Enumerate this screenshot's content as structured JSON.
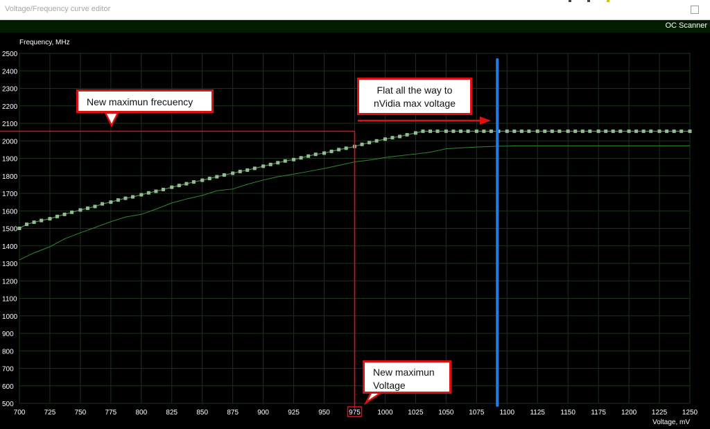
{
  "window": {
    "title": "Voltage/Frequency curve editor",
    "oc_scanner_label": "OC Scanner"
  },
  "annotations": {
    "max_frequency": "New maximun frecuency",
    "flat_line1": "Flat all the way to",
    "flat_line2": "nVidia max voltage",
    "max_voltage_line1": "New maximun",
    "max_voltage_line2": "Voltage",
    "highlighted_tick": "975",
    "highlight_voltage": 975,
    "highlight_frequency": 2055,
    "vertical_marker_voltage": 1092,
    "colors": {
      "annotation": "#e01010",
      "marker": "#1e7ee6",
      "curve": "#8fbf8f",
      "base_curve": "#2e8b2e"
    }
  },
  "chart_data": {
    "type": "line",
    "ylabel": "Frequency, MHz",
    "xlabel": "Voltage, mV",
    "xlim": [
      700,
      1250
    ],
    "ylim": [
      500,
      2500
    ],
    "x_ticks": [
      700,
      725,
      750,
      775,
      800,
      825,
      850,
      875,
      900,
      925,
      950,
      975,
      1000,
      1025,
      1050,
      1075,
      1100,
      1125,
      1150,
      1175,
      1200,
      1225,
      1250
    ],
    "y_ticks": [
      500,
      600,
      700,
      800,
      900,
      1000,
      1100,
      1200,
      1300,
      1400,
      1500,
      1600,
      1700,
      1800,
      1900,
      2000,
      2100,
      2200,
      2300,
      2400,
      2500
    ],
    "grid": true,
    "series": [
      {
        "role": "edited-curve-with-points",
        "points": [
          [
            700,
            1500
          ],
          [
            706,
            1523
          ],
          [
            712,
            1535
          ],
          [
            718,
            1545
          ],
          [
            725,
            1555
          ],
          [
            731,
            1568
          ],
          [
            737,
            1580
          ],
          [
            743,
            1592
          ],
          [
            750,
            1605
          ],
          [
            756,
            1615
          ],
          [
            762,
            1625
          ],
          [
            768,
            1640
          ],
          [
            775,
            1650
          ],
          [
            781,
            1662
          ],
          [
            787,
            1672
          ],
          [
            793,
            1680
          ],
          [
            800,
            1692
          ],
          [
            806,
            1703
          ],
          [
            812,
            1712
          ],
          [
            818,
            1722
          ],
          [
            825,
            1735
          ],
          [
            831,
            1745
          ],
          [
            837,
            1755
          ],
          [
            843,
            1765
          ],
          [
            850,
            1775
          ],
          [
            856,
            1785
          ],
          [
            862,
            1795
          ],
          [
            868,
            1805
          ],
          [
            875,
            1815
          ],
          [
            881,
            1825
          ],
          [
            887,
            1833
          ],
          [
            893,
            1843
          ],
          [
            900,
            1855
          ],
          [
            906,
            1865
          ],
          [
            912,
            1875
          ],
          [
            918,
            1885
          ],
          [
            925,
            1893
          ],
          [
            931,
            1903
          ],
          [
            937,
            1913
          ],
          [
            943,
            1923
          ],
          [
            950,
            1930
          ],
          [
            956,
            1940
          ],
          [
            962,
            1950
          ],
          [
            968,
            1958
          ],
          [
            975,
            1968
          ],
          [
            981,
            1980
          ],
          [
            987,
            1990
          ],
          [
            993,
            2000
          ],
          [
            1000,
            2010
          ],
          [
            1006,
            2018
          ],
          [
            1012,
            2025
          ],
          [
            1018,
            2035
          ],
          [
            1025,
            2045
          ],
          [
            1031,
            2055
          ],
          [
            1037,
            2055
          ],
          [
            1043,
            2055
          ],
          [
            1050,
            2055
          ],
          [
            1056,
            2055
          ],
          [
            1062,
            2055
          ],
          [
            1068,
            2055
          ],
          [
            1075,
            2055
          ],
          [
            1081,
            2055
          ],
          [
            1087,
            2055
          ],
          [
            1093,
            2055
          ],
          [
            1100,
            2055
          ],
          [
            1106,
            2055
          ],
          [
            1112,
            2055
          ],
          [
            1118,
            2055
          ],
          [
            1125,
            2055
          ],
          [
            1131,
            2055
          ],
          [
            1137,
            2055
          ],
          [
            1143,
            2055
          ],
          [
            1150,
            2055
          ],
          [
            1156,
            2055
          ],
          [
            1162,
            2055
          ],
          [
            1168,
            2055
          ],
          [
            1175,
            2055
          ],
          [
            1181,
            2055
          ],
          [
            1187,
            2055
          ],
          [
            1193,
            2055
          ],
          [
            1200,
            2055
          ],
          [
            1206,
            2055
          ],
          [
            1212,
            2055
          ],
          [
            1218,
            2055
          ],
          [
            1225,
            2055
          ],
          [
            1231,
            2055
          ],
          [
            1237,
            2055
          ],
          [
            1243,
            2055
          ],
          [
            1250,
            2055
          ]
        ]
      },
      {
        "role": "base-curve",
        "points": [
          [
            700,
            1320
          ],
          [
            712,
            1360
          ],
          [
            725,
            1395
          ],
          [
            737,
            1440
          ],
          [
            750,
            1475
          ],
          [
            762,
            1505
          ],
          [
            775,
            1538
          ],
          [
            787,
            1565
          ],
          [
            800,
            1580
          ],
          [
            812,
            1610
          ],
          [
            825,
            1645
          ],
          [
            837,
            1668
          ],
          [
            850,
            1688
          ],
          [
            862,
            1715
          ],
          [
            875,
            1725
          ],
          [
            887,
            1752
          ],
          [
            900,
            1776
          ],
          [
            912,
            1795
          ],
          [
            925,
            1810
          ],
          [
            937,
            1825
          ],
          [
            950,
            1842
          ],
          [
            962,
            1860
          ],
          [
            975,
            1880
          ],
          [
            987,
            1890
          ],
          [
            1000,
            1905
          ],
          [
            1012,
            1915
          ],
          [
            1025,
            1925
          ],
          [
            1037,
            1935
          ],
          [
            1050,
            1955
          ],
          [
            1062,
            1960
          ],
          [
            1075,
            1965
          ],
          [
            1087,
            1968
          ],
          [
            1093,
            1970
          ],
          [
            1100,
            1970
          ],
          [
            1106,
            1972
          ],
          [
            1112,
            1972
          ],
          [
            1125,
            1972
          ],
          [
            1137,
            1972
          ],
          [
            1150,
            1972
          ],
          [
            1162,
            1972
          ],
          [
            1175,
            1972
          ],
          [
            1187,
            1972
          ],
          [
            1200,
            1972
          ],
          [
            1212,
            1972
          ],
          [
            1225,
            1972
          ],
          [
            1237,
            1972
          ],
          [
            1250,
            1972
          ]
        ]
      }
    ]
  }
}
